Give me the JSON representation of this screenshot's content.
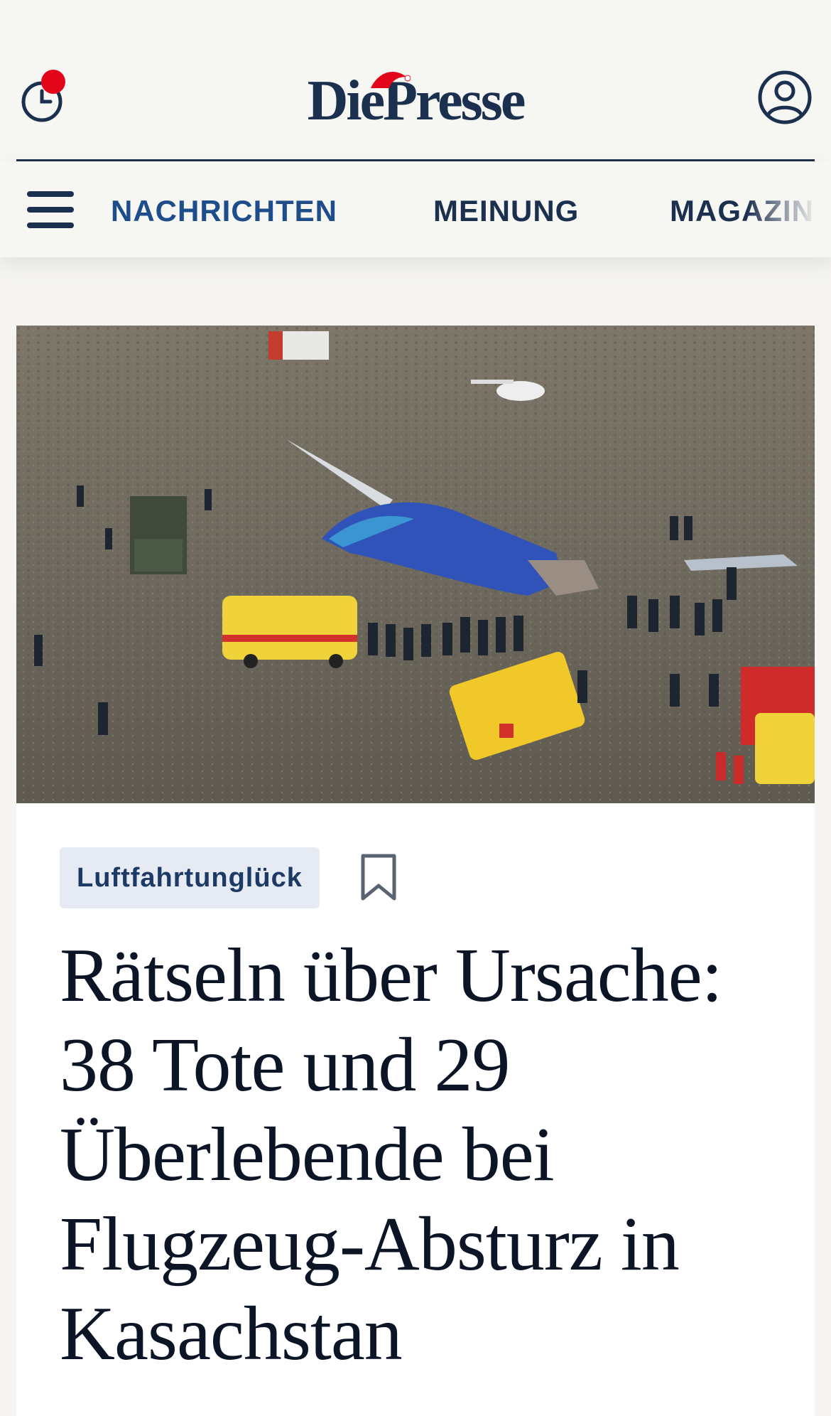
{
  "header": {
    "logo": "DiePresse",
    "icons": {
      "history": "clock-icon",
      "notification": "notification-dot",
      "user": "user-account-icon",
      "logo_decoration": "santa-hat-icon"
    }
  },
  "nav": {
    "menu_icon": "hamburger-menu-icon",
    "items": [
      {
        "label": "NACHRICHTEN"
      },
      {
        "label": "MEINUNG"
      },
      {
        "label": "MAGAZIN"
      }
    ]
  },
  "article": {
    "tag": "Luftfahrtunglück",
    "bookmark_icon": "bookmark-icon",
    "headline": "Rätseln über Ursache: 38 Tote und 29 Überlebende bei Flugzeug-Absturz in Kasachstan"
  },
  "colors": {
    "brand_navy": "#1b2f4f",
    "nav_active": "#1d4d8a",
    "notification": "#e3061a",
    "tag_bg": "#e6ebf3"
  }
}
